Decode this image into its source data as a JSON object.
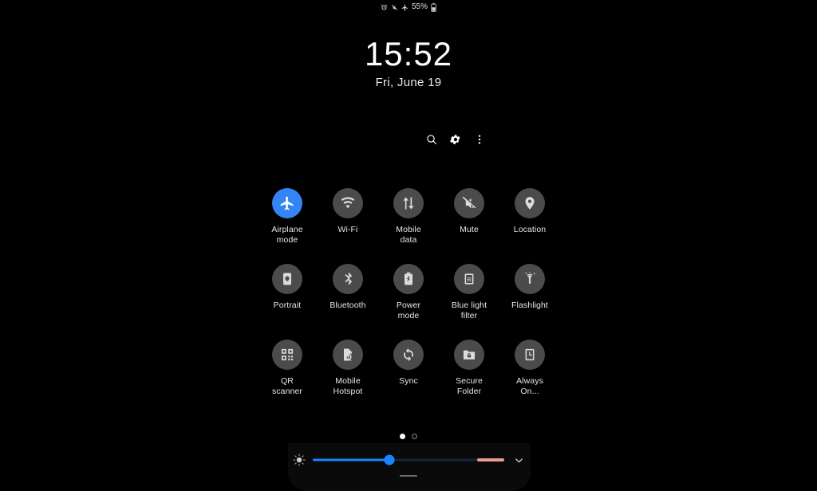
{
  "status_bar": {
    "icons": [
      "alarm-icon",
      "mute-icon",
      "airplane-icon"
    ],
    "battery_text": "55%",
    "battery_icon": "battery-icon"
  },
  "clock": {
    "time": "15:52",
    "date": "Fri, June 19"
  },
  "header_actions": [
    {
      "name": "search-icon",
      "label": "Search"
    },
    {
      "name": "gear-icon",
      "label": "Settings"
    },
    {
      "name": "overflow-menu-icon",
      "label": "More options"
    }
  ],
  "tiles": {
    "rows": [
      [
        {
          "id": "airplane-mode",
          "label": "Airplane\nmode",
          "icon": "airplane-icon",
          "active": true
        },
        {
          "id": "wifi",
          "label": "Wi-Fi",
          "icon": "wifi-icon",
          "active": false
        },
        {
          "id": "mobile-data",
          "label": "Mobile\ndata",
          "icon": "mobile-data-icon",
          "active": false
        },
        {
          "id": "mute",
          "label": "Mute",
          "icon": "mute-icon",
          "active": false
        },
        {
          "id": "location",
          "label": "Location",
          "icon": "location-pin-icon",
          "active": false
        }
      ],
      [
        {
          "id": "portrait",
          "label": "Portrait",
          "icon": "portrait-rotation-icon",
          "active": false
        },
        {
          "id": "bluetooth",
          "label": "Bluetooth",
          "icon": "bluetooth-icon",
          "active": false
        },
        {
          "id": "power-mode",
          "label": "Power\nmode",
          "icon": "power-mode-icon",
          "active": false
        },
        {
          "id": "blue-light-filter",
          "label": "Blue light\nfilter",
          "icon": "blue-light-filter-icon",
          "active": false
        },
        {
          "id": "flashlight",
          "label": "Flashlight",
          "icon": "flashlight-icon",
          "active": false
        }
      ],
      [
        {
          "id": "qr-scanner",
          "label": "QR\nscanner",
          "icon": "qr-code-icon",
          "active": false
        },
        {
          "id": "mobile-hotspot",
          "label": "Mobile\nHotspot",
          "icon": "hotspot-icon",
          "active": false
        },
        {
          "id": "sync",
          "label": "Sync",
          "icon": "sync-icon",
          "active": false
        },
        {
          "id": "secure-folder",
          "label": "Secure\nFolder",
          "icon": "secure-folder-icon",
          "active": false
        },
        {
          "id": "always-on-display",
          "label": "Always\nOn...",
          "icon": "always-on-display-icon",
          "active": false
        }
      ]
    ]
  },
  "pagination": {
    "pages": 2,
    "active_page": 1
  },
  "brightness": {
    "icon": "brightness-sun-icon",
    "value_percent": 40,
    "expand_icon": "chevron-down-icon"
  },
  "colors": {
    "accent_blue": "#3584f5",
    "slider_blue": "#1a84ff",
    "tile_inactive": "#4b4b4b",
    "slider_warning": "#e99d91",
    "background": "#000000"
  }
}
